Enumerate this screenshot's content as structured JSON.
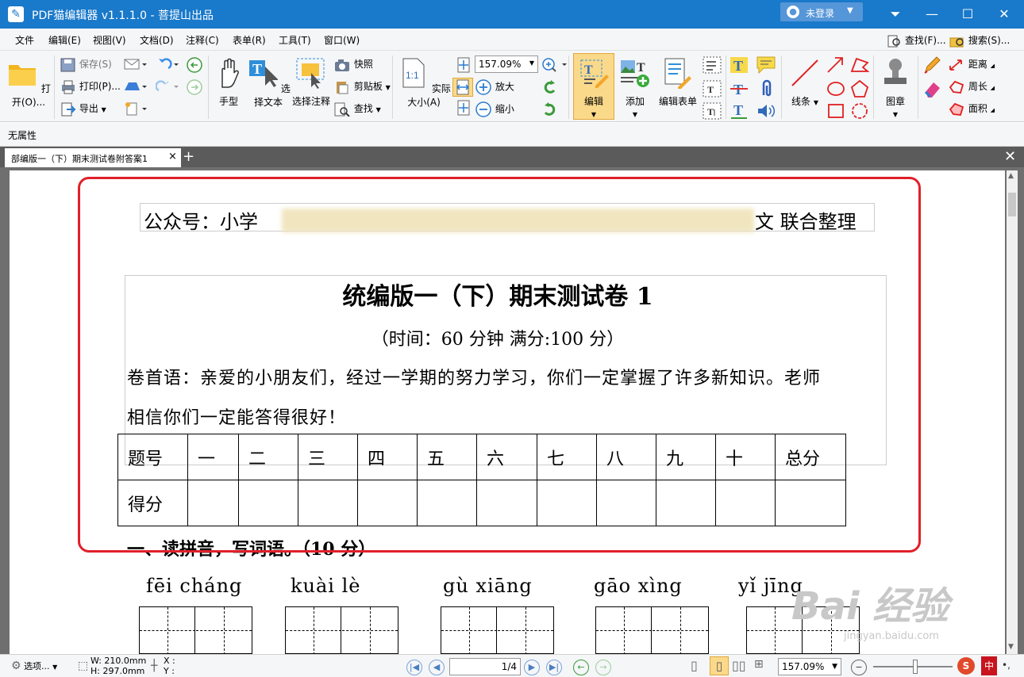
{
  "window": {
    "title": "PDF猫编辑器 v1.1.1.0 - 菩提山出品",
    "login_label": "未登录",
    "app_icon": "pen-icon"
  },
  "menu": {
    "items": [
      "文件",
      "编辑(E)",
      "视图(V)",
      "文档(D)",
      "注释(C)",
      "表单(R)",
      "工具(T)",
      "窗口(W)"
    ],
    "find": "查找(F)...",
    "search": "搜索(S)..."
  },
  "ribbon": {
    "open": "打开(O)...",
    "save": "保存(S)",
    "print": "打印(P)...",
    "export": "导出",
    "hand": "手型",
    "select_text": "选择文本",
    "select_annot": "选择注释",
    "snapshot": "快照",
    "clipboard": "剪贴板",
    "find": "查找",
    "actual_size": "实际大小(A)",
    "zoom_value": "157.09%",
    "zoom_in": "放大",
    "zoom_out": "缩小",
    "edit": "编辑",
    "add": "添加",
    "edit_form": "编辑表单",
    "lines": "线条",
    "stamp": "图章",
    "distance": "距离",
    "perimeter": "周长",
    "area": "面积",
    "actual_size_glyph": "1:1"
  },
  "props": {
    "label": "无属性"
  },
  "tab": {
    "label": "部编版一（下）期末测试卷附答案1",
    "close": "×",
    "add": "+"
  },
  "document": {
    "publisher_prefix": "公众号：小学",
    "publisher_suffix": "文 联合整理",
    "heading": "统编版一（下）期末测试卷 1",
    "subheading": "（时间：60 分钟        满分:100 分）",
    "preface_line1": "卷首语：亲爱的小朋友们，经过一学期的努力学习，你们一定掌握了许多新知识。老师",
    "preface_line2": "相信你们一定能答得很好！",
    "score_header": [
      "题号",
      "一",
      "二",
      "三",
      "四",
      "五",
      "六",
      "七",
      "八",
      "九",
      "十",
      "总分"
    ],
    "score_row_label": "得分",
    "section1": "一、读拼音，写词语。（10 分）",
    "pinyin": [
      "fēi cháng",
      "kuài lè",
      "gù xiāng",
      "gāo xìng",
      "yǐ jīng"
    ]
  },
  "watermark": {
    "line1": "Bai 经验",
    "line2": "jingyan.baidu.com"
  },
  "status": {
    "options": "选项...",
    "width": "W: 210.0mm",
    "height": "H: 297.0mm",
    "x": "X :",
    "y": "Y :",
    "page": "1/4",
    "zoom": "157.09%",
    "ime": "中"
  },
  "colors": {
    "titlebar": "#1979ca",
    "annotation_box": "#e0202a"
  }
}
